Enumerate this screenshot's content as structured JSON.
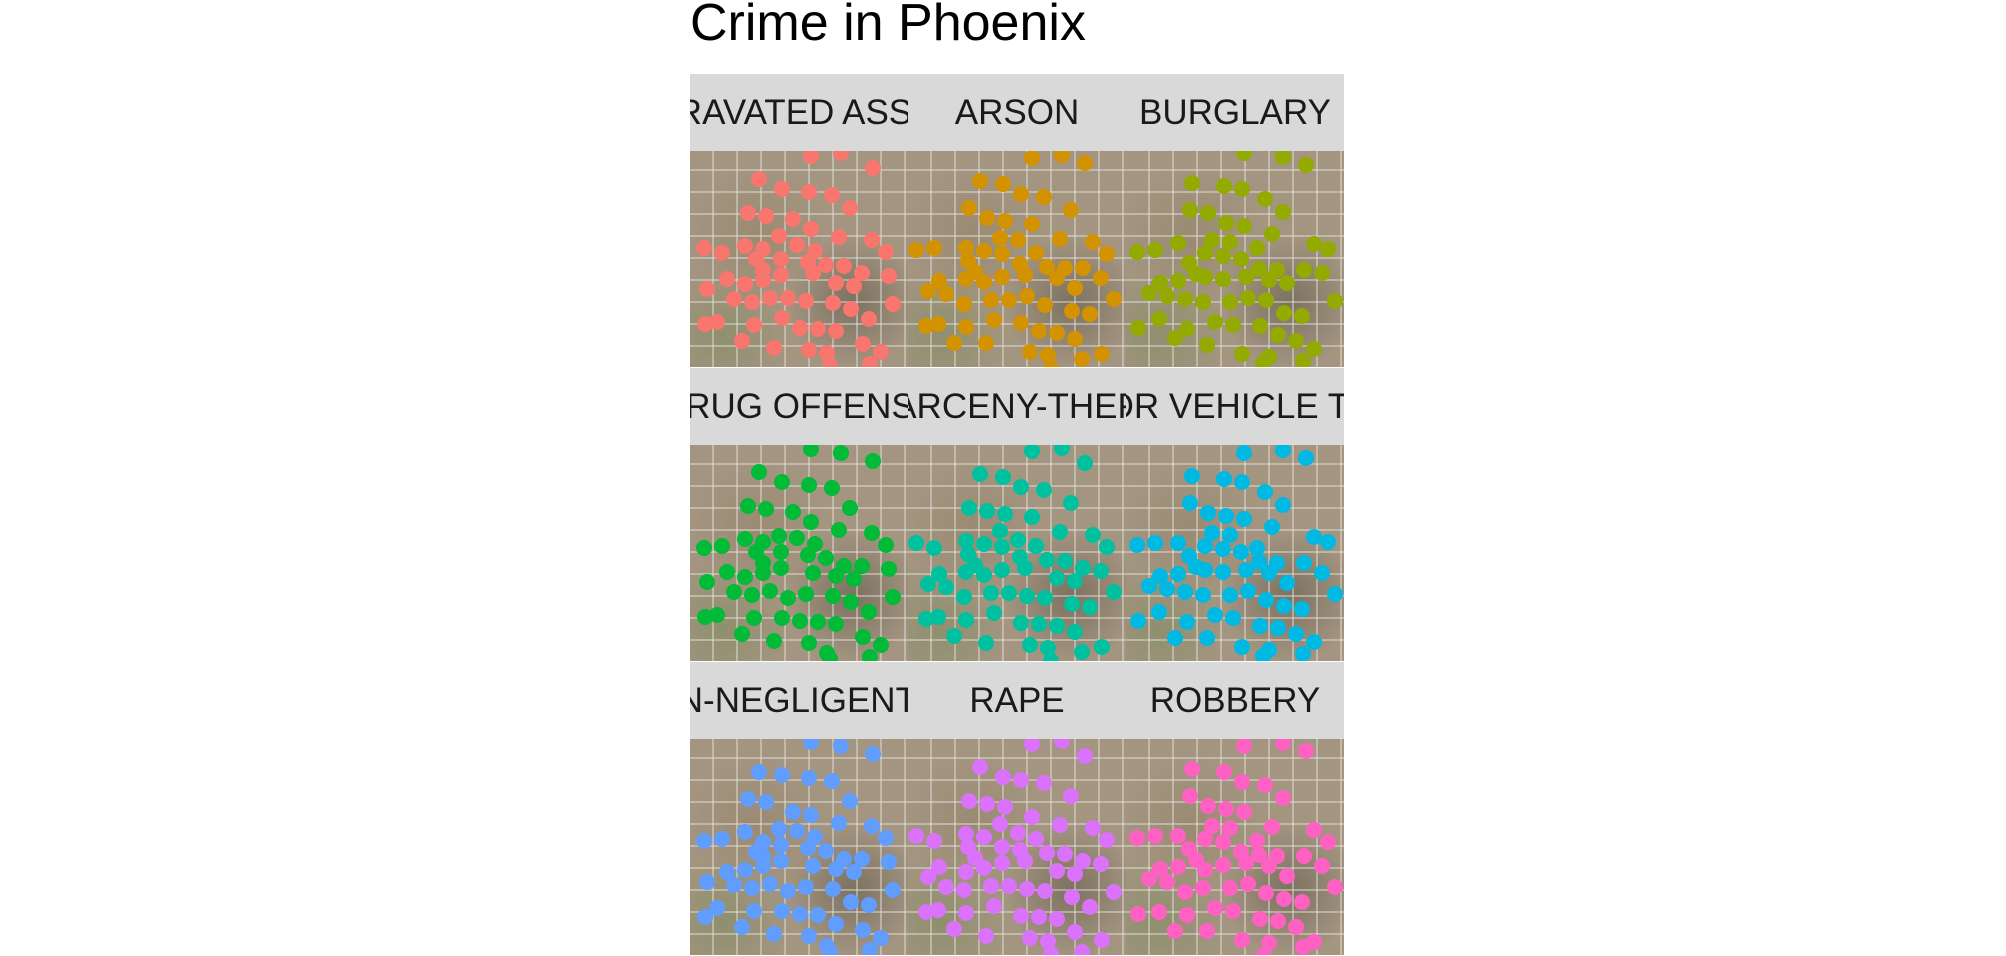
{
  "title": "Crime in Phoenix",
  "facets": [
    {
      "label": "AGGRAVATED ASSAULT",
      "color": "#F8766D"
    },
    {
      "label": "ARSON",
      "color": "#D39200"
    },
    {
      "label": "BURGLARY",
      "color": "#93AA00"
    },
    {
      "label": "DRUG OFFENSE",
      "color": "#00BA38"
    },
    {
      "label": "LARCENY-THEFT",
      "color": "#00C19F"
    },
    {
      "label": "MOTOR VEHICLE THEFT",
      "color": "#00B9E3"
    },
    {
      "label": "MURDER AND NON-NEGLIGENT MANSLAUGHTER",
      "color": "#619CFF"
    },
    {
      "label": "RAPE",
      "color": "#DB72FB"
    },
    {
      "label": "ROBBERY",
      "color": "#FF61C3"
    }
  ]
}
